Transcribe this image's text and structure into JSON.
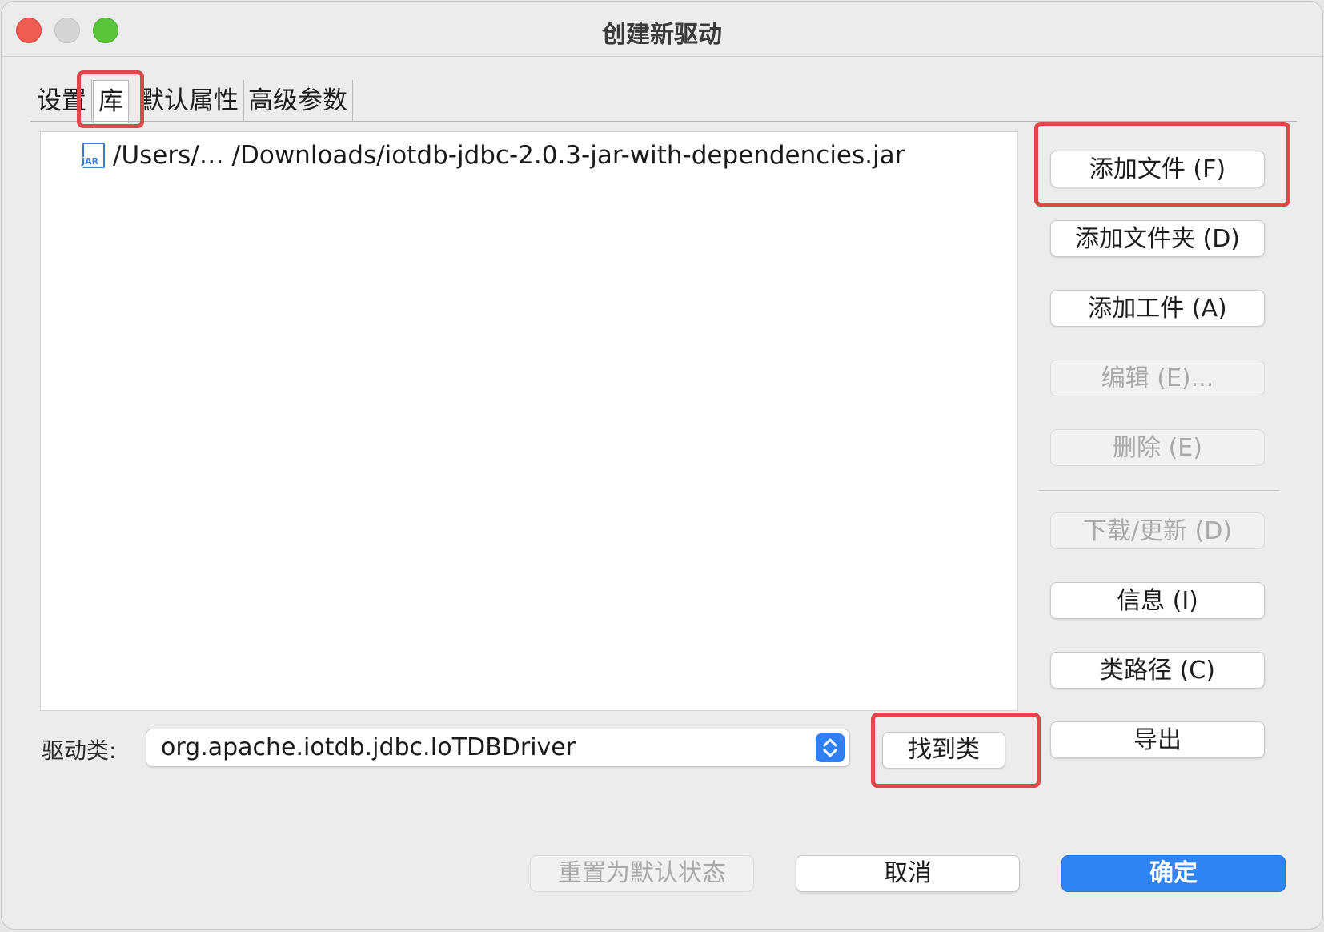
{
  "window": {
    "title": "创建新驱动"
  },
  "tabs": [
    {
      "label": "设置"
    },
    {
      "label": "库"
    },
    {
      "label": "默认属性"
    },
    {
      "label": "高级参数"
    }
  ],
  "active_tab": "库",
  "files": [
    {
      "icon": "jar-file-icon",
      "icon_text": "JAR",
      "path": "/Users/… /Downloads/iotdb-jdbc-2.0.3-jar-with-dependencies.jar"
    }
  ],
  "side_buttons": {
    "add_file": "添加文件 (F)",
    "add_folder": "添加文件夹 (D)",
    "add_artifact": "添加工件 (A)",
    "edit": "编辑 (E)...",
    "delete": "删除 (E)",
    "download_update": "下载/更新 (D)",
    "info": "信息 (I)",
    "classpath": "类路径 (C)",
    "export": "导出"
  },
  "driver": {
    "label": "驱动类:",
    "value": "org.apache.iotdb.jdbc.IoTDBDriver",
    "find_button": "找到类"
  },
  "footer": {
    "reset": "重置为默认状态",
    "cancel": "取消",
    "ok": "确定"
  },
  "colors": {
    "highlight": "#e0474a",
    "primary": "#2f84f2"
  }
}
